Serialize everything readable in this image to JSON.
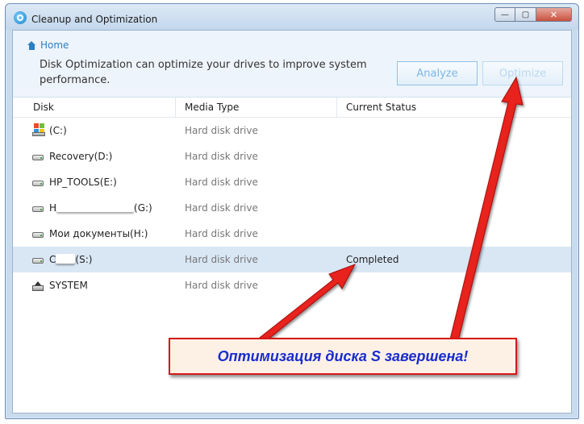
{
  "window": {
    "title": "Cleanup and Optimization",
    "controls": {
      "minimize": "—",
      "maximize": "▢",
      "close": "✕"
    }
  },
  "breadcrumb": {
    "home": "Home"
  },
  "description": "Disk Optimization can optimize your drives to improve system performance.",
  "buttons": {
    "analyze": "Analyze",
    "optimize": "Optimize"
  },
  "table": {
    "columns": [
      "Disk",
      "Media Type",
      "Current Status"
    ],
    "rows": [
      {
        "disk": "(C:)",
        "media": "Hard disk drive",
        "status": "",
        "icon": "windows-drive-icon"
      },
      {
        "disk": "Recovery(D:)",
        "media": "Hard disk drive",
        "status": "",
        "icon": "hard-drive-icon"
      },
      {
        "disk": "HP_TOOLS(E:)",
        "media": "Hard disk drive",
        "status": "",
        "icon": "hard-drive-icon"
      },
      {
        "disk_prefix": "H",
        "disk_suffix": "(G:)",
        "media": "Hard disk drive",
        "status": "",
        "icon": "hard-drive-icon"
      },
      {
        "disk": "Мои документы(H:)",
        "media": "Hard disk drive",
        "status": "",
        "icon": "hard-drive-icon"
      },
      {
        "disk_prefix": "C",
        "disk_suffix": "(S:)",
        "media": "Hard disk drive",
        "status": "Completed",
        "icon": "hard-drive-icon",
        "selected": true
      },
      {
        "disk": "SYSTEM",
        "media": "Hard disk drive",
        "status": "",
        "icon": "system-drive-icon"
      }
    ]
  },
  "annotation": {
    "text": "Оптимизация диска S завершена!"
  },
  "colors": {
    "accent": "#2b7fc4",
    "selected_row": "#d9e7f5",
    "annotation_border": "#d61818",
    "annotation_text": "#1a2ccf",
    "arrow": "#e8201c"
  }
}
